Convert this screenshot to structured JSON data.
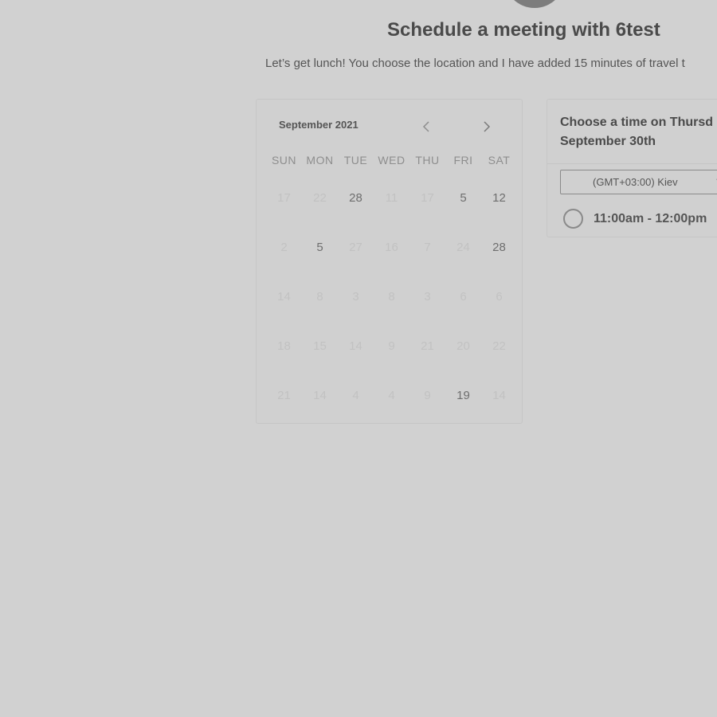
{
  "header": {
    "title": "Schedule a meeting with 6test",
    "description": "Let’s get lunch! You choose the location and I have added 15 minutes of travel t"
  },
  "calendar": {
    "month": "September 2021",
    "prev_icon": "chevron-left-icon",
    "next_icon": "chevron-right-icon",
    "weekdays": [
      "SUN",
      "MON",
      "TUE",
      "WED",
      "THU",
      "FRI",
      "SAT"
    ],
    "weeks": [
      [
        {
          "d": "17",
          "a": false
        },
        {
          "d": "22",
          "a": false
        },
        {
          "d": "28",
          "a": true
        },
        {
          "d": "11",
          "a": false
        },
        {
          "d": "17",
          "a": false
        },
        {
          "d": "5",
          "a": true
        },
        {
          "d": "12",
          "a": true
        }
      ],
      [
        {
          "d": "2",
          "a": false
        },
        {
          "d": "5",
          "a": true
        },
        {
          "d": "27",
          "a": false
        },
        {
          "d": "16",
          "a": false
        },
        {
          "d": "7",
          "a": false
        },
        {
          "d": "24",
          "a": false
        },
        {
          "d": "28",
          "a": true
        }
      ],
      [
        {
          "d": "14",
          "a": false
        },
        {
          "d": "8",
          "a": false
        },
        {
          "d": "3",
          "a": false
        },
        {
          "d": "8",
          "a": false
        },
        {
          "d": "3",
          "a": false
        },
        {
          "d": "6",
          "a": false
        },
        {
          "d": "6",
          "a": false
        }
      ],
      [
        {
          "d": "18",
          "a": false
        },
        {
          "d": "15",
          "a": false
        },
        {
          "d": "14",
          "a": false
        },
        {
          "d": "9",
          "a": false
        },
        {
          "d": "21",
          "a": false
        },
        {
          "d": "20",
          "a": false
        },
        {
          "d": "22",
          "a": false
        }
      ],
      [
        {
          "d": "21",
          "a": false
        },
        {
          "d": "14",
          "a": false
        },
        {
          "d": "4",
          "a": false
        },
        {
          "d": "4",
          "a": false
        },
        {
          "d": "9",
          "a": false
        },
        {
          "d": "19",
          "a": true
        },
        {
          "d": "14",
          "a": false
        }
      ]
    ]
  },
  "times": {
    "title_line1": "Choose a time on Thursd",
    "title_line2": "September 30th",
    "timezone": "(GMT+03:00) Kiev",
    "timezone_caret": "chevron-down-icon",
    "slots": [
      "11:00am - 12:00pm"
    ]
  }
}
